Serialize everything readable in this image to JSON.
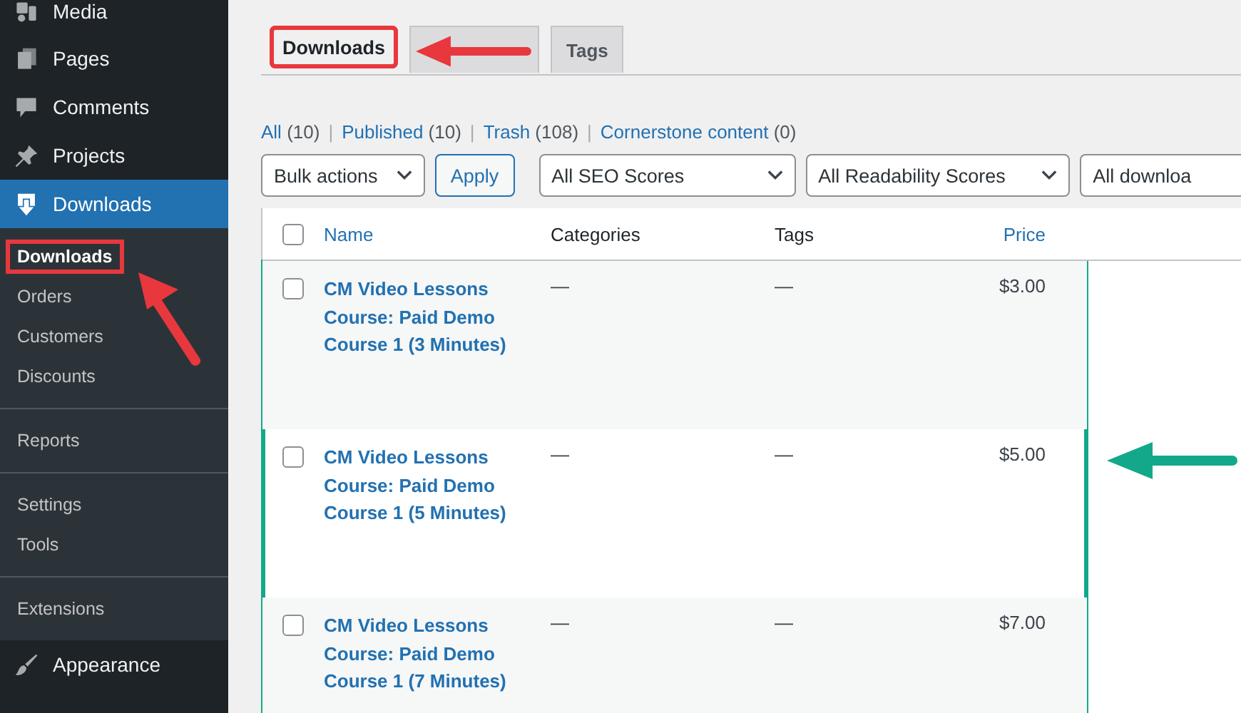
{
  "sidebar": {
    "items": [
      {
        "label": "Media",
        "kind": "media",
        "selected": false
      },
      {
        "label": "Pages",
        "kind": "pages",
        "selected": false
      },
      {
        "label": "Comments",
        "kind": "comments",
        "selected": false
      },
      {
        "label": "Projects",
        "kind": "pin",
        "selected": false
      },
      {
        "label": "Downloads",
        "kind": "download",
        "selected": true,
        "children": [
          {
            "label": "Downloads",
            "selected": true,
            "highlighted": true
          },
          {
            "label": "Orders",
            "selected": false,
            "highlighted": false
          },
          {
            "label": "Customers",
            "selected": false,
            "highlighted": false
          },
          {
            "label": "Discounts",
            "selected": false,
            "highlighted": false
          },
          {
            "label": "Reports",
            "selected": false,
            "highlighted": false,
            "divider_before": true
          },
          {
            "label": "Settings",
            "selected": false,
            "highlighted": false,
            "divider_before": true
          },
          {
            "label": "Tools",
            "selected": false,
            "highlighted": false
          },
          {
            "label": "Extensions",
            "selected": false,
            "highlighted": false,
            "divider_before": true
          }
        ]
      },
      {
        "label": "Appearance",
        "kind": "brush",
        "selected": false
      }
    ]
  },
  "tabs": [
    {
      "label": "Downloads",
      "selected": true,
      "highlighted": true
    },
    {
      "selected": false,
      "highlighted": false
    },
    {
      "label": "Tags",
      "selected": false,
      "highlighted": false
    }
  ],
  "views": [
    {
      "label": "All",
      "count": "(10)"
    },
    {
      "separator": "|",
      "label": "Published",
      "count": "(10)"
    },
    {
      "separator": "|",
      "label": "Trash",
      "count": "(108)"
    },
    {
      "separator": "|",
      "label": "Cornerstone content",
      "count": "(0)"
    }
  ],
  "filters": {
    "bulk": "Bulk actions",
    "apply": "Apply",
    "selects": [
      "All SEO Scores",
      "All Readability Scores",
      "All downloa"
    ]
  },
  "table": {
    "highlighted": true,
    "select_all_checked": false,
    "columns": [
      "Name",
      "Categories",
      "Tags",
      "Price"
    ],
    "rows": [
      {
        "name": "CM Video Lessons Course: Paid Demo Course 1 (3 Minutes)",
        "categories": "—",
        "tags": "—",
        "price": "$3.00",
        "checked": false
      },
      {
        "name": "CM Video Lessons Course: Paid Demo Course 1 (5 Minutes)",
        "categories": "—",
        "tags": "—",
        "price": "$5.00",
        "checked": false
      },
      {
        "name": "CM Video Lessons Course: Paid Demo Course 1 (7 Minutes)",
        "categories": "—",
        "tags": "—",
        "price": "$7.00",
        "checked": false
      }
    ]
  }
}
